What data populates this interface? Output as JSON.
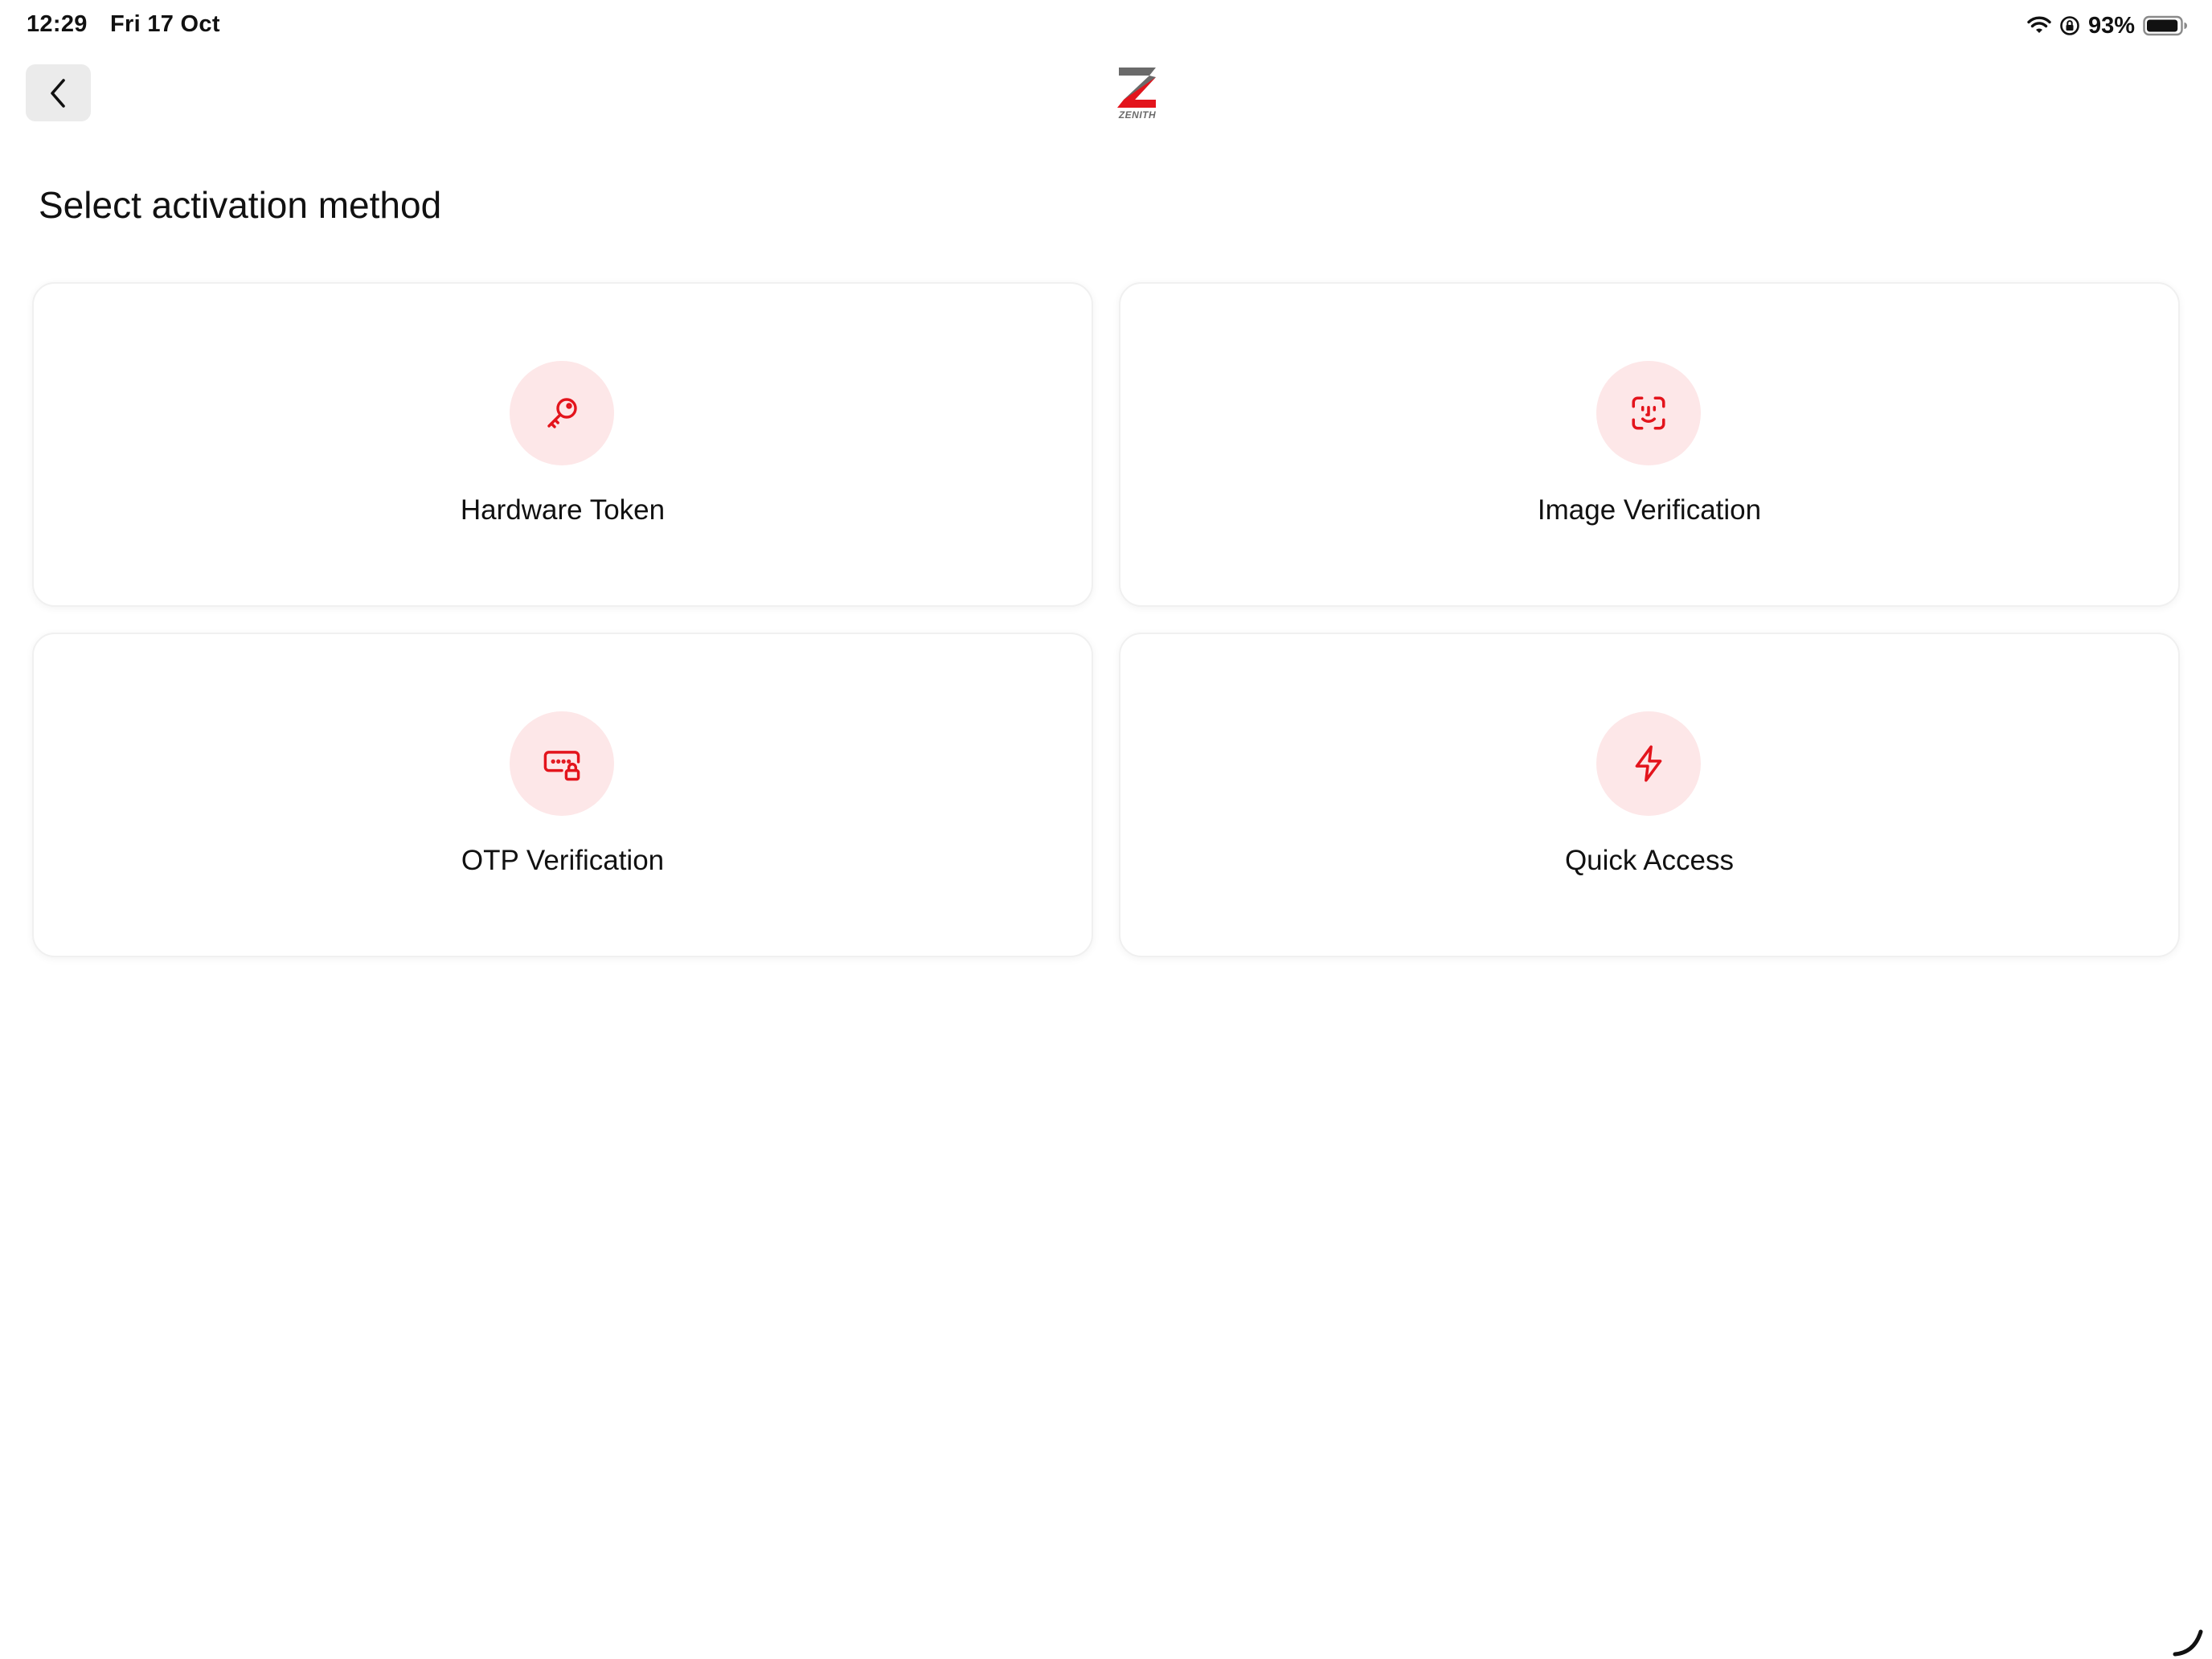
{
  "status_bar": {
    "time": "12:29",
    "date": "Fri 17 Oct",
    "battery_percent_label": "93%",
    "battery_level": 0.93,
    "icons": [
      "wifi-icon",
      "orientation-lock-icon",
      "battery-icon"
    ]
  },
  "header": {
    "back_icon": "chevron-left-icon",
    "logo_text": "ZENITH"
  },
  "page": {
    "title": "Select activation method"
  },
  "options": [
    {
      "label": "Hardware Token",
      "icon": "key-icon"
    },
    {
      "label": "Image Verification",
      "icon": "face-id-icon"
    },
    {
      "label": "OTP Verification",
      "icon": "password-lock-icon"
    },
    {
      "label": "Quick Access",
      "icon": "lightning-icon"
    }
  ],
  "colors": {
    "accent": "#e3141c",
    "icon_bg": "#fde7e8",
    "back_button_bg": "#ebebeb",
    "logo_gray": "#6a6a6a"
  }
}
